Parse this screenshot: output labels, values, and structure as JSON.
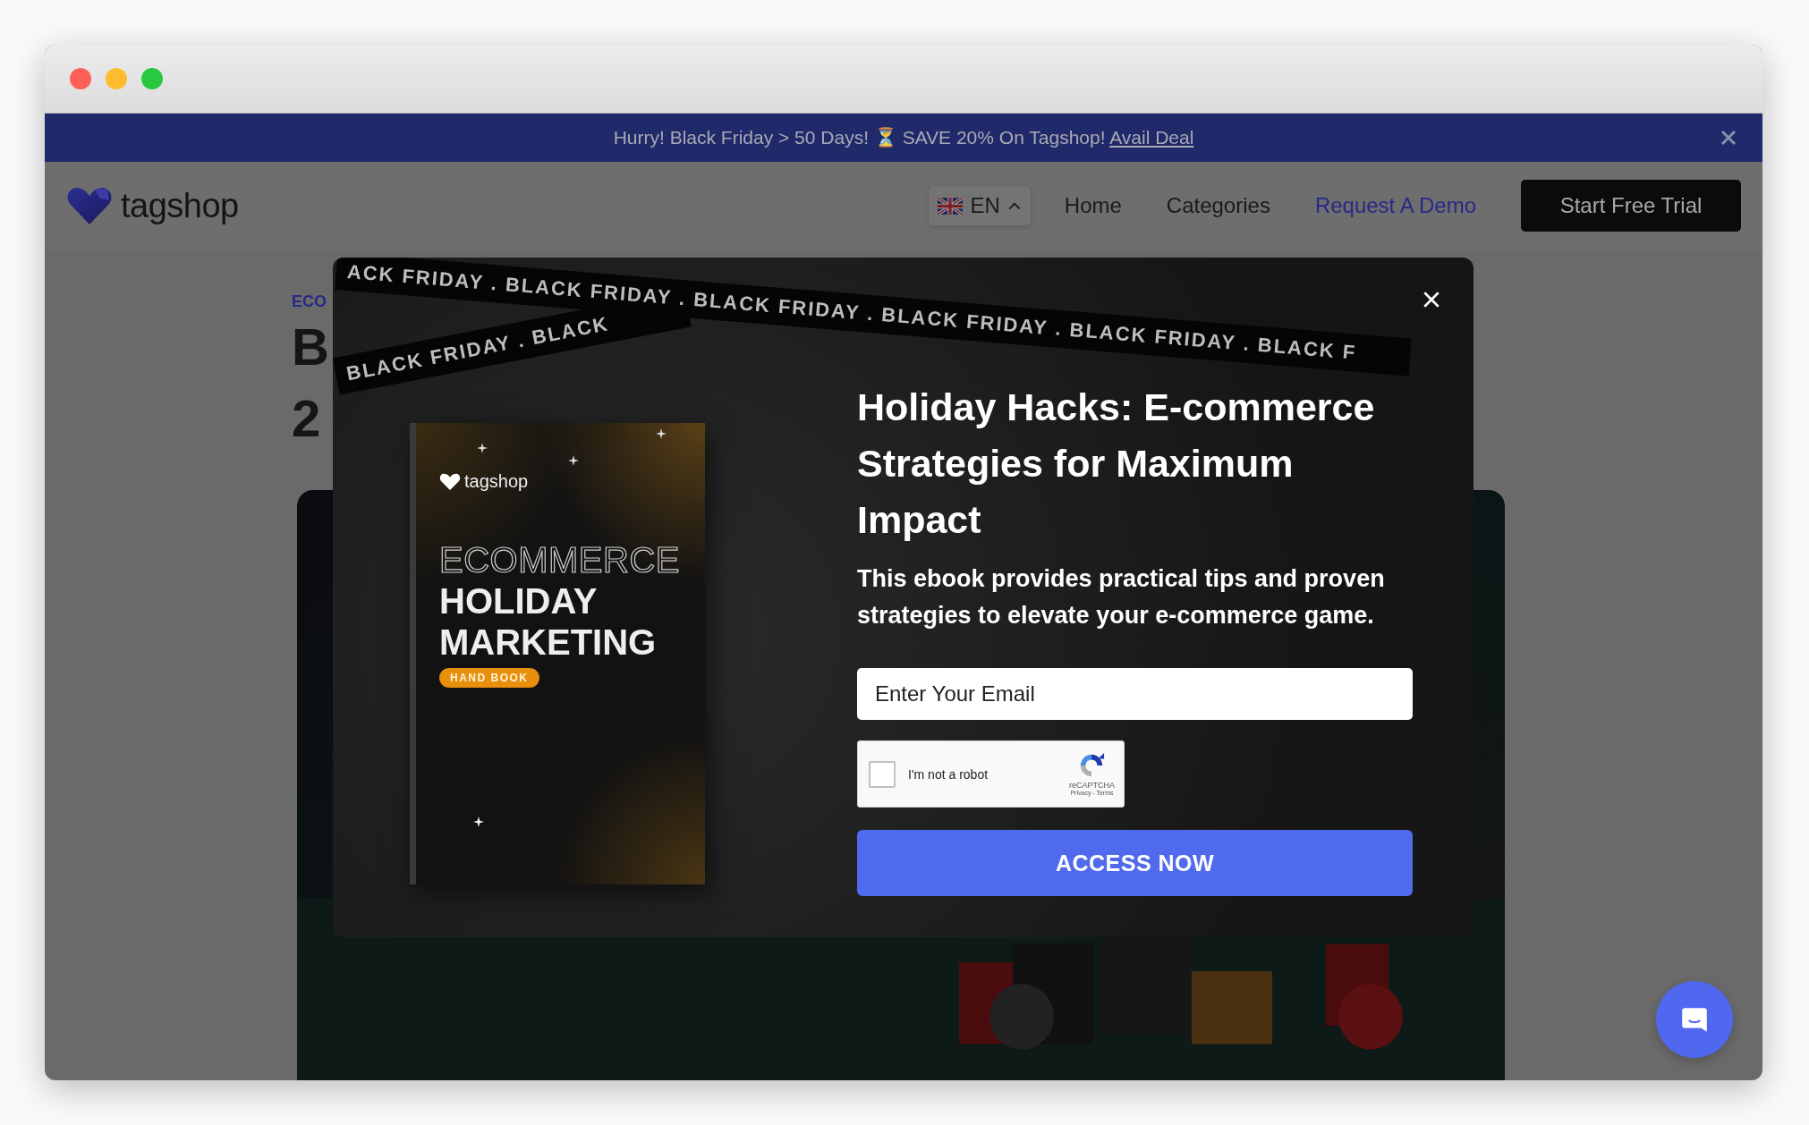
{
  "announcement": {
    "text": "Hurry! Black Friday > 50 Days! ⏳ SAVE 20% On Tagshop!",
    "link": "Avail Deal"
  },
  "nav": {
    "logo": "tagshop",
    "language": "EN",
    "items": [
      {
        "label": "Home",
        "accent": false
      },
      {
        "label": "Categories",
        "accent": false
      },
      {
        "label": "Request A Demo",
        "accent": true
      }
    ],
    "cta": "Start Free Trial"
  },
  "article": {
    "category": "ECO",
    "title_lines": [
      "B",
      "2"
    ]
  },
  "modal": {
    "ribbons": [
      "BLACK FRIDAY . BLACK",
      "ACK FRIDAY . BLACK FRIDAY . BLACK FRIDAY . BLACK FRIDAY . BLACK FRIDAY . BLACK F"
    ],
    "book": {
      "brand": "tagshop",
      "outline_line": "ECOMMERCE",
      "lines": [
        "HOLIDAY",
        "MARKETING"
      ],
      "badge": "HAND BOOK"
    },
    "title": "Holiday Hacks: E-commerce Strategies for Maximum Impact",
    "description": "This ebook provides practical tips and proven strategies to elevate your e-commerce game.",
    "email": {
      "placeholder": "Enter Your Email"
    },
    "captcha": {
      "label": "I'm not a robot",
      "checked": false,
      "brand": "reCAPTCHA",
      "links": "Privacy - Terms"
    },
    "button": "ACCESS NOW"
  }
}
